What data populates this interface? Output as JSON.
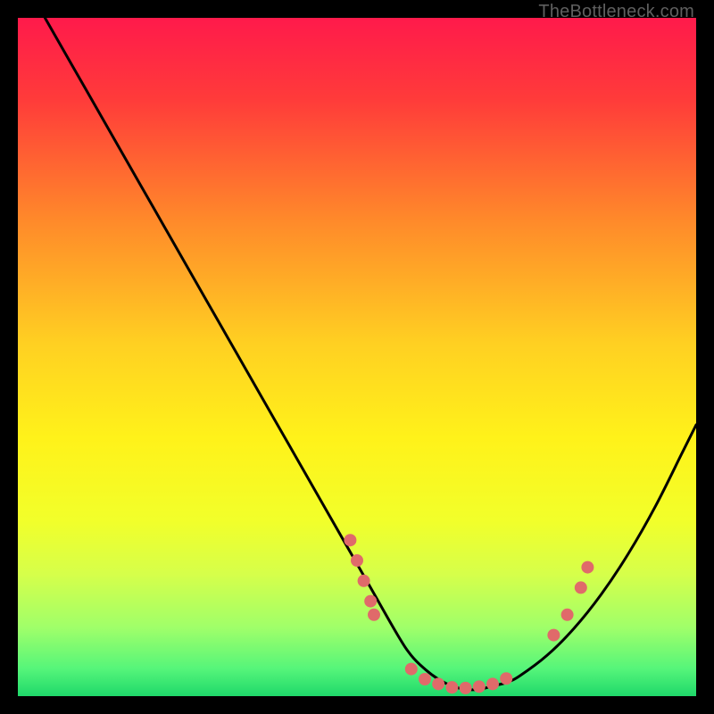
{
  "watermark": "TheBottleneck.com",
  "chart_data": {
    "type": "line",
    "title": "",
    "xlabel": "",
    "ylabel": "",
    "xlim": [
      0,
      100
    ],
    "ylim": [
      0,
      100
    ],
    "background_gradient": {
      "stops": [
        {
          "offset": 0.0,
          "color": "#ff1a4b"
        },
        {
          "offset": 0.12,
          "color": "#ff3b3a"
        },
        {
          "offset": 0.3,
          "color": "#ff8a2a"
        },
        {
          "offset": 0.48,
          "color": "#ffd022"
        },
        {
          "offset": 0.62,
          "color": "#fff21a"
        },
        {
          "offset": 0.74,
          "color": "#f2ff2a"
        },
        {
          "offset": 0.82,
          "color": "#d6ff4a"
        },
        {
          "offset": 0.9,
          "color": "#9fff6a"
        },
        {
          "offset": 0.96,
          "color": "#55f57a"
        },
        {
          "offset": 1.0,
          "color": "#1fd86a"
        }
      ]
    },
    "series": [
      {
        "name": "curve",
        "color": "#000000",
        "x": [
          4,
          8,
          12,
          16,
          20,
          24,
          28,
          32,
          36,
          40,
          44,
          48,
          52,
          56,
          58,
          60,
          62,
          64,
          66,
          68,
          70,
          72,
          74,
          78,
          82,
          86,
          90,
          94,
          98,
          100
        ],
        "y": [
          100,
          93,
          86,
          79,
          72,
          65,
          58,
          51,
          44,
          37,
          30,
          23,
          16,
          9,
          6,
          4,
          2.5,
          1.5,
          1,
          1,
          1.5,
          2,
          3,
          6,
          10,
          15,
          21,
          28,
          36,
          40
        ]
      }
    ],
    "scatter": {
      "name": "dots",
      "color": "#e06a6a",
      "radius": 7,
      "points": [
        {
          "x": 49,
          "y": 23
        },
        {
          "x": 50,
          "y": 20
        },
        {
          "x": 51,
          "y": 17
        },
        {
          "x": 52,
          "y": 14
        },
        {
          "x": 52.5,
          "y": 12
        },
        {
          "x": 58,
          "y": 4
        },
        {
          "x": 60,
          "y": 2.5
        },
        {
          "x": 62,
          "y": 1.8
        },
        {
          "x": 64,
          "y": 1.3
        },
        {
          "x": 66,
          "y": 1.2
        },
        {
          "x": 68,
          "y": 1.4
        },
        {
          "x": 70,
          "y": 1.8
        },
        {
          "x": 72,
          "y": 2.6
        },
        {
          "x": 79,
          "y": 9
        },
        {
          "x": 81,
          "y": 12
        },
        {
          "x": 83,
          "y": 16
        },
        {
          "x": 84,
          "y": 19
        }
      ]
    }
  }
}
